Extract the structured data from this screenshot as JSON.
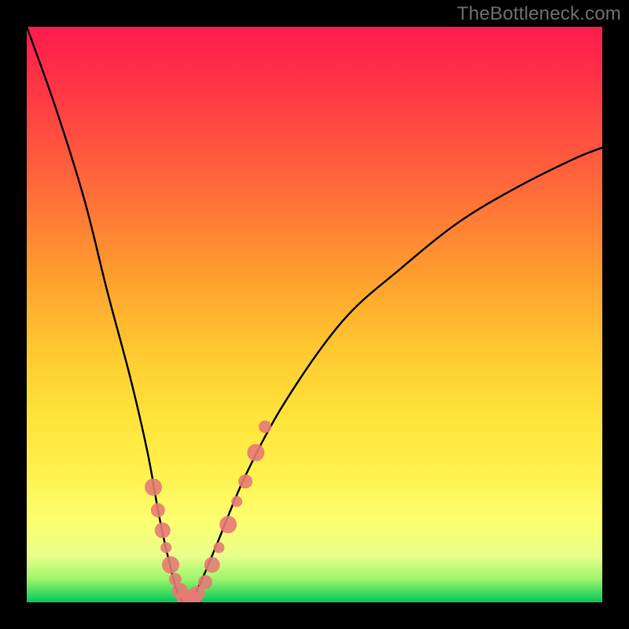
{
  "watermark": "TheBottleneck.com",
  "colors": {
    "frame": "#000000",
    "curve": "#000000",
    "dot": "#e77a74",
    "gradient_stops": [
      {
        "pos": 0,
        "color": "#ff1a4d"
      },
      {
        "pos": 12,
        "color": "#ff3a44"
      },
      {
        "pos": 28,
        "color": "#ff6a3a"
      },
      {
        "pos": 42,
        "color": "#ff9a2e"
      },
      {
        "pos": 56,
        "color": "#ffc830"
      },
      {
        "pos": 68,
        "color": "#ffe43a"
      },
      {
        "pos": 78,
        "color": "#fff250"
      },
      {
        "pos": 86,
        "color": "#fcff70"
      },
      {
        "pos": 92,
        "color": "#e8ff8a"
      },
      {
        "pos": 96,
        "color": "#9cf56a"
      },
      {
        "pos": 100,
        "color": "#00c95a"
      }
    ]
  },
  "chart_data": {
    "type": "line",
    "title": "",
    "xlabel": "",
    "ylabel": "",
    "xlim": [
      0,
      100
    ],
    "ylim": [
      0,
      100
    ],
    "series": [
      {
        "name": "bottleneck-curve",
        "x": [
          0,
          5,
          10,
          14,
          18,
          21,
          23,
          25,
          26.5,
          28,
          30,
          33,
          38,
          45,
          55,
          65,
          75,
          85,
          95,
          100
        ],
        "values": [
          100,
          86,
          70,
          54,
          39,
          26,
          15,
          6,
          1,
          0,
          3,
          10,
          22,
          35,
          49,
          58,
          66,
          72,
          77,
          79
        ]
      }
    ],
    "markers": {
      "name": "highlight-dots",
      "x": [
        22.0,
        22.8,
        23.6,
        24.2,
        25.0,
        25.8,
        26.6,
        27.5,
        28.6,
        29.6,
        31.0,
        32.2,
        33.4,
        35.0,
        36.5,
        38.0,
        39.8,
        41.4
      ],
      "values": [
        20.0,
        16.0,
        12.5,
        9.5,
        6.5,
        4.0,
        2.0,
        0.8,
        0.5,
        1.5,
        3.5,
        6.5,
        9.5,
        13.5,
        17.5,
        21.0,
        26.0,
        30.5
      ],
      "radius": [
        11,
        9,
        10,
        7,
        11,
        8,
        10,
        11,
        11,
        10,
        9,
        10,
        7,
        11,
        7,
        9,
        11,
        8
      ]
    }
  }
}
